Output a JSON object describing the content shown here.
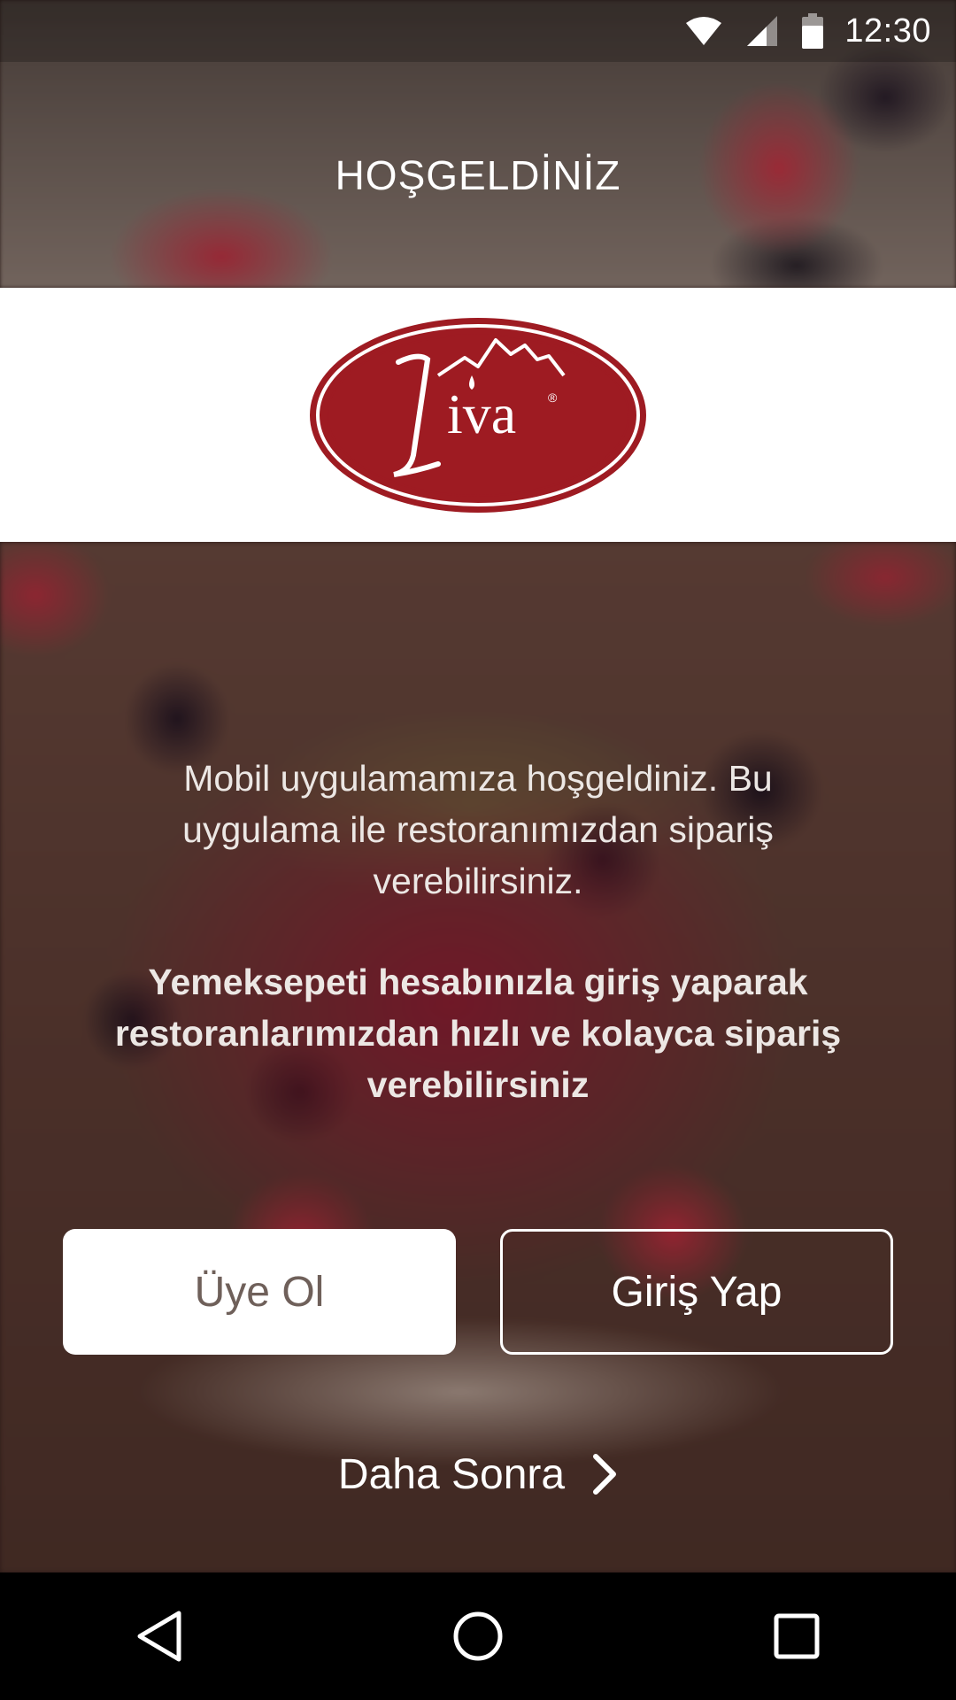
{
  "status_bar": {
    "time": "12:30",
    "icons": [
      "wifi-icon",
      "cellular-signal-icon",
      "battery-icon"
    ]
  },
  "header": {
    "title": "HOŞGELDİNİZ"
  },
  "logo": {
    "text": "Liva",
    "colors": {
      "primary": "#9e1b22",
      "ring": "#ffffff"
    }
  },
  "intro": {
    "paragraph_1": "Mobil uygulamamıza hoşgeldiniz. Bu uygulama ile restoranımızdan sipariş verebilirsiniz.",
    "paragraph_2": "Yemeksepeti hesabınızla giriş yaparak restoranlarımızdan hızlı ve kolayca sipariş verebilirsiniz"
  },
  "actions": {
    "signup_label": "Üye Ol",
    "login_label": "Giriş Yap",
    "later_label": "Daha Sonra",
    "later_icon": "chevron-right-icon"
  },
  "nav_bar": {
    "buttons": [
      "back-icon",
      "home-icon",
      "recents-icon"
    ]
  },
  "colors": {
    "signup_text": "#6f605a",
    "nav_background": "#000000"
  }
}
